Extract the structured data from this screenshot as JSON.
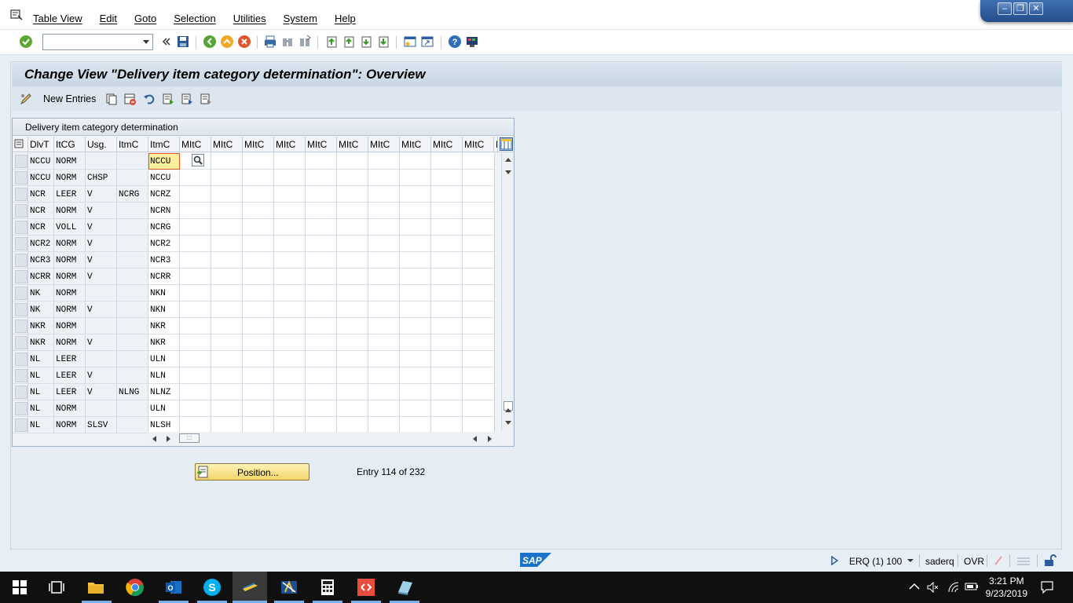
{
  "menubar": {
    "items": [
      "Table View",
      "Edit",
      "Goto",
      "Selection",
      "Utilities",
      "System",
      "Help"
    ]
  },
  "toolbar": {
    "command_field_value": ""
  },
  "screen": {
    "title": "Change View \"Delivery item category determination\": Overview"
  },
  "app_toolbar": {
    "new_entries_label": "New Entries"
  },
  "table": {
    "caption": "Delivery item category determination",
    "columns": [
      "DlvT",
      "ItCG",
      "Usg.",
      "ItmC",
      "ItmC",
      "MItC",
      "MItC",
      "MItC",
      "MItC",
      "MItC",
      "MItC",
      "MItC",
      "MItC",
      "MItC",
      "MItC",
      "M"
    ],
    "rows": [
      [
        "NCCU",
        "NORM",
        "",
        "",
        "NCCU"
      ],
      [
        "NCCU",
        "NORM",
        "CHSP",
        "",
        "NCCU"
      ],
      [
        "NCR",
        "LEER",
        "V",
        "NCRG",
        "NCRZ"
      ],
      [
        "NCR",
        "NORM",
        "V",
        "",
        "NCRN"
      ],
      [
        "NCR",
        "VOLL",
        "V",
        "",
        "NCRG"
      ],
      [
        "NCR2",
        "NORM",
        "V",
        "",
        "NCR2"
      ],
      [
        "NCR3",
        "NORM",
        "V",
        "",
        "NCR3"
      ],
      [
        "NCRR",
        "NORM",
        "V",
        "",
        "NCRR"
      ],
      [
        "NK",
        "NORM",
        "",
        "",
        "NKN"
      ],
      [
        "NK",
        "NORM",
        "V",
        "",
        "NKN"
      ],
      [
        "NKR",
        "NORM",
        "",
        "",
        "NKR"
      ],
      [
        "NKR",
        "NORM",
        "V",
        "",
        "NKR"
      ],
      [
        "NL",
        "LEER",
        "",
        "",
        "ULN"
      ],
      [
        "NL",
        "LEER",
        "V",
        "",
        "NLN"
      ],
      [
        "NL",
        "LEER",
        "V",
        "NLNG",
        "NLNZ"
      ],
      [
        "NL",
        "NORM",
        "",
        "",
        "ULN"
      ],
      [
        "NL",
        "NORM",
        "SLSV",
        "",
        "NLSH"
      ]
    ]
  },
  "position_button": {
    "label": "Position..."
  },
  "entry_info": "Entry 114 of 232",
  "statusbar": {
    "system": "ERQ (1) 100",
    "user": "saderq",
    "mode": "OVR"
  },
  "taskbar": {
    "time": "3:21 PM",
    "date": "9/23/2019"
  },
  "colors": {
    "accent": "#0a6ed1",
    "focus_cell": "#ffef9c",
    "position_button": "#f1d46a"
  }
}
